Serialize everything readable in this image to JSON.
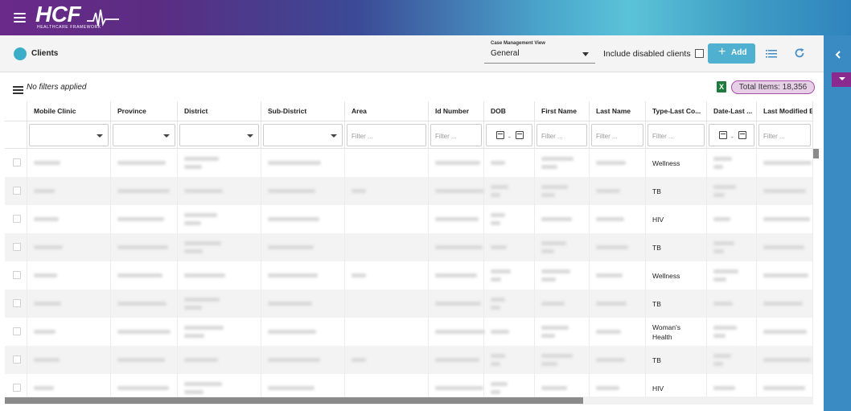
{
  "header": {
    "logo_text": "HCF",
    "logo_subtitle": "HEALTHCARE FRAMEWORK",
    "menu_icon": "hamburger-icon"
  },
  "subheader": {
    "title": "Clients",
    "case_view_label": "Case Management View",
    "case_view_value": "General",
    "include_disabled_label": "Include disabled clients",
    "add_label": "Add",
    "add_icon": "plus-icon",
    "list_icon": "list-icon",
    "refresh_icon": "refresh-icon"
  },
  "filterbar": {
    "no_filters": "No filters applied",
    "export_icon": "excel-icon",
    "excel_glyph": "X",
    "total_items": "Total Items: 18,356"
  },
  "rail": {
    "collapse_icon": "chevron-left-icon",
    "accent_color": "#8b2a8e"
  },
  "colors": {
    "accent": "#4fb0cf",
    "badge_border": "#a64ea8",
    "badge_bg": "#e8cfe8",
    "rail": "#3a8ac4"
  },
  "table": {
    "columns": [
      {
        "label": "",
        "filter": "none"
      },
      {
        "label": "Mobile Clinic",
        "filter": "select"
      },
      {
        "label": "Province",
        "filter": "select"
      },
      {
        "label": "District",
        "filter": "select"
      },
      {
        "label": "Sub-District",
        "filter": "select"
      },
      {
        "label": "Area",
        "filter": "text"
      },
      {
        "label": "Id Number",
        "filter": "text"
      },
      {
        "label": "DOB",
        "filter": "date"
      },
      {
        "label": "First Name",
        "filter": "text"
      },
      {
        "label": "Last Name",
        "filter": "text"
      },
      {
        "label": "Type-Last Co...",
        "filter": "text"
      },
      {
        "label": "Date-Last ...",
        "filter": "date"
      },
      {
        "label": "Last Modified By",
        "filter": "text"
      }
    ],
    "filter_placeholder": "Filter ...",
    "date_separator": "-",
    "rows": [
      {
        "type": "Wellness"
      },
      {
        "type": "TB"
      },
      {
        "type": "HIV"
      },
      {
        "type": "TB"
      },
      {
        "type": "Wellness"
      },
      {
        "type": "TB"
      },
      {
        "type": "Woman's Health"
      },
      {
        "type": "TB"
      },
      {
        "type": "HIV"
      }
    ]
  }
}
